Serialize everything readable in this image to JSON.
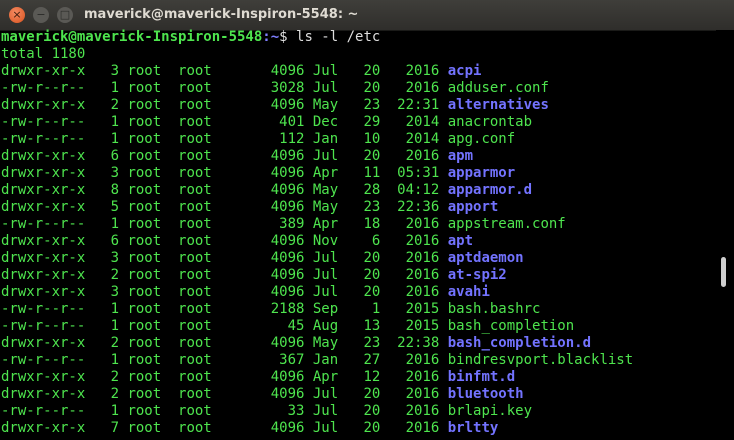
{
  "window": {
    "title": "maverick@maverick-Inspiron-5548: ~",
    "close_glyph": "×",
    "minimize_glyph": "−",
    "maximize_glyph": "□"
  },
  "prompt": {
    "user_host": "maverick@maverick-Inspiron-5548",
    "path": ":~",
    "symbol": "$",
    "command": " ls -l /etc"
  },
  "total_line": "total 1180",
  "entries": [
    {
      "perms": "drwxr-xr-x",
      "links": "3",
      "owner": "root",
      "group": "root",
      "size": "4096",
      "month": "Jul",
      "day": "20",
      "time": "2016",
      "name": "acpi",
      "is_dir": true
    },
    {
      "perms": "-rw-r--r--",
      "links": "1",
      "owner": "root",
      "group": "root",
      "size": "3028",
      "month": "Jul",
      "day": "20",
      "time": "2016",
      "name": "adduser.conf",
      "is_dir": false
    },
    {
      "perms": "drwxr-xr-x",
      "links": "2",
      "owner": "root",
      "group": "root",
      "size": "4096",
      "month": "May",
      "day": "23",
      "time": "22:31",
      "name": "alternatives",
      "is_dir": true
    },
    {
      "perms": "-rw-r--r--",
      "links": "1",
      "owner": "root",
      "group": "root",
      "size": "401",
      "month": "Dec",
      "day": "29",
      "time": "2014",
      "name": "anacrontab",
      "is_dir": false
    },
    {
      "perms": "-rw-r--r--",
      "links": "1",
      "owner": "root",
      "group": "root",
      "size": "112",
      "month": "Jan",
      "day": "10",
      "time": "2014",
      "name": "apg.conf",
      "is_dir": false
    },
    {
      "perms": "drwxr-xr-x",
      "links": "6",
      "owner": "root",
      "group": "root",
      "size": "4096",
      "month": "Jul",
      "day": "20",
      "time": "2016",
      "name": "apm",
      "is_dir": true
    },
    {
      "perms": "drwxr-xr-x",
      "links": "3",
      "owner": "root",
      "group": "root",
      "size": "4096",
      "month": "Apr",
      "day": "11",
      "time": "05:31",
      "name": "apparmor",
      "is_dir": true
    },
    {
      "perms": "drwxr-xr-x",
      "links": "8",
      "owner": "root",
      "group": "root",
      "size": "4096",
      "month": "May",
      "day": "28",
      "time": "04:12",
      "name": "apparmor.d",
      "is_dir": true
    },
    {
      "perms": "drwxr-xr-x",
      "links": "5",
      "owner": "root",
      "group": "root",
      "size": "4096",
      "month": "May",
      "day": "23",
      "time": "22:36",
      "name": "apport",
      "is_dir": true
    },
    {
      "perms": "-rw-r--r--",
      "links": "1",
      "owner": "root",
      "group": "root",
      "size": "389",
      "month": "Apr",
      "day": "18",
      "time": "2016",
      "name": "appstream.conf",
      "is_dir": false
    },
    {
      "perms": "drwxr-xr-x",
      "links": "6",
      "owner": "root",
      "group": "root",
      "size": "4096",
      "month": "Nov",
      "day": "6",
      "time": "2016",
      "name": "apt",
      "is_dir": true
    },
    {
      "perms": "drwxr-xr-x",
      "links": "3",
      "owner": "root",
      "group": "root",
      "size": "4096",
      "month": "Jul",
      "day": "20",
      "time": "2016",
      "name": "aptdaemon",
      "is_dir": true
    },
    {
      "perms": "drwxr-xr-x",
      "links": "2",
      "owner": "root",
      "group": "root",
      "size": "4096",
      "month": "Jul",
      "day": "20",
      "time": "2016",
      "name": "at-spi2",
      "is_dir": true
    },
    {
      "perms": "drwxr-xr-x",
      "links": "3",
      "owner": "root",
      "group": "root",
      "size": "4096",
      "month": "Jul",
      "day": "20",
      "time": "2016",
      "name": "avahi",
      "is_dir": true
    },
    {
      "perms": "-rw-r--r--",
      "links": "1",
      "owner": "root",
      "group": "root",
      "size": "2188",
      "month": "Sep",
      "day": "1",
      "time": "2015",
      "name": "bash.bashrc",
      "is_dir": false
    },
    {
      "perms": "-rw-r--r--",
      "links": "1",
      "owner": "root",
      "group": "root",
      "size": "45",
      "month": "Aug",
      "day": "13",
      "time": "2015",
      "name": "bash_completion",
      "is_dir": false
    },
    {
      "perms": "drwxr-xr-x",
      "links": "2",
      "owner": "root",
      "group": "root",
      "size": "4096",
      "month": "May",
      "day": "23",
      "time": "22:38",
      "name": "bash_completion.d",
      "is_dir": true
    },
    {
      "perms": "-rw-r--r--",
      "links": "1",
      "owner": "root",
      "group": "root",
      "size": "367",
      "month": "Jan",
      "day": "27",
      "time": "2016",
      "name": "bindresvport.blacklist",
      "is_dir": false
    },
    {
      "perms": "drwxr-xr-x",
      "links": "2",
      "owner": "root",
      "group": "root",
      "size": "4096",
      "month": "Apr",
      "day": "12",
      "time": "2016",
      "name": "binfmt.d",
      "is_dir": true
    },
    {
      "perms": "drwxr-xr-x",
      "links": "2",
      "owner": "root",
      "group": "root",
      "size": "4096",
      "month": "Jul",
      "day": "20",
      "time": "2016",
      "name": "bluetooth",
      "is_dir": true
    },
    {
      "perms": "-rw-r--r--",
      "links": "1",
      "owner": "root",
      "group": "root",
      "size": "33",
      "month": "Jul",
      "day": "20",
      "time": "2016",
      "name": "brlapi.key",
      "is_dir": false
    },
    {
      "perms": "drwxr-xr-x",
      "links": "7",
      "owner": "root",
      "group": "root",
      "size": "4096",
      "month": "Jul",
      "day": "20",
      "time": "2016",
      "name": "brltty",
      "is_dir": true
    }
  ],
  "colors": {
    "text": "#4ee44e",
    "directory": "#7373ff",
    "background": "#000000",
    "titlebar": "#3c3b37",
    "close_button": "#e9602d"
  },
  "icons": [
    "close-icon",
    "minimize-icon",
    "maximize-icon"
  ]
}
